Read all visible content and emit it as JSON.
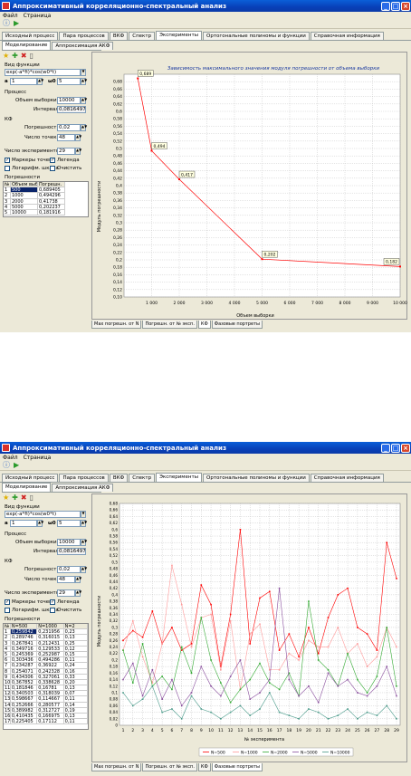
{
  "app": {
    "title": "Аппроксимативный корреляционно-спектральный анализ",
    "menu": [
      "Файл",
      "Страница"
    ]
  },
  "tabs": [
    "Исходный процесс",
    "Пара процессов",
    "ВКФ",
    "Спектр",
    "Эксперименты",
    "Ортогональные полиномы и функции",
    "Справочная информация"
  ],
  "active_tab": "Эксперименты",
  "subtabs": [
    "Моделирование",
    "Аппроксимация АКФ"
  ],
  "left_panel": {
    "func_label": "Вид функции",
    "func_value": "exp(-a*fi)*cos(w0*t)",
    "a_label": "a",
    "a_value": "1",
    "w0_label": "ω0",
    "w0_value": "5",
    "process_label": "Процесс",
    "sample_label": "Объем выборки",
    "sample_value_1": "10000",
    "sample_value_2": "10000",
    "interval_label": "Интервал",
    "interval_value": "0,0816497",
    "kf_label": "КФ",
    "err_label": "Погрешность",
    "err_value": "0,02",
    "points_label": "Число точек",
    "points_value": "48",
    "experiments_label": "Число экспериментов",
    "experiments_value": "29",
    "markers_label": "Маркеры точек",
    "legend_label": "Легенда",
    "log_label": "Логарифм. шкала",
    "clear_label": "Очистить",
    "errors_label": "Погрешности"
  },
  "table1": {
    "headers": [
      "№",
      "Объем выборки",
      "Погрешн."
    ],
    "rows": [
      [
        "1",
        "500",
        "0,689405"
      ],
      [
        "2",
        "1000",
        "0,494296"
      ],
      [
        "3",
        "2000",
        "0,41738"
      ],
      [
        "4",
        "5000",
        "0,202237"
      ],
      [
        "5",
        "10000",
        "0,181916"
      ]
    ]
  },
  "table2": {
    "headers": [
      "№",
      "N=500",
      "N=1000",
      "N=2"
    ],
    "rows": [
      [
        "1",
        "0,259842",
        "0,231956",
        "0,23"
      ],
      [
        "2",
        "0,289746",
        "0,316015",
        "0,13"
      ],
      [
        "3",
        "0,267841",
        "0,212431",
        "0,25"
      ],
      [
        "4",
        "0,349716",
        "0,129533",
        "0,12"
      ],
      [
        "5",
        "0,245369",
        "0,252987",
        "0,15"
      ],
      [
        "6",
        "0,303436",
        "0,494286",
        "0,11"
      ],
      [
        "7",
        "0,234287",
        "0,36922",
        "0,24"
      ],
      [
        "8",
        "0,254071",
        "0,242328",
        "0,16"
      ],
      [
        "9",
        "0,434306",
        "0,327061",
        "0,33"
      ],
      [
        "10",
        "0,367852",
        "0,338628",
        "0,20"
      ],
      [
        "11",
        "0,181846",
        "0,16781",
        "0,13"
      ],
      [
        "12",
        "0,340503",
        "0,318039",
        "0,07"
      ],
      [
        "13",
        "0,598667",
        "0,114667",
        "0,11"
      ],
      [
        "14",
        "0,252666",
        "0,280577",
        "0,14"
      ],
      [
        "15",
        "0,389982",
        "0,312727",
        "0,19"
      ],
      [
        "16",
        "0,410435",
        "0,166975",
        "0,13"
      ],
      [
        "17",
        "0,225405",
        "0,17112",
        "0,11"
      ]
    ]
  },
  "chart_tabs": [
    "Мах погрешн. от N",
    "Погрешн. от № эксп.",
    "КФ",
    "Фазовые портреты"
  ],
  "chart1_tab": "КФ",
  "chart2_tab": "Фазовые портреты",
  "chart_data": [
    {
      "type": "line",
      "title": "Зависимость максимального значения модуля погрешности от объема выборки",
      "xlabel": "Объем выборки",
      "ylabel": "Модуль погрешности",
      "x": [
        500,
        1000,
        2000,
        5000,
        10000
      ],
      "series": [
        {
          "values": [
            0.689,
            0.494,
            0.417,
            0.202,
            0.182
          ]
        }
      ],
      "data_labels": [
        "0,689",
        "0,494",
        "0,417",
        "0,202",
        "0,182"
      ],
      "xlim": [
        0,
        10000
      ],
      "ylim": [
        0.1,
        0.7
      ],
      "x_ticks": [
        "1 000",
        "2 000",
        "3 000",
        "4 000",
        "5 000",
        "6 000",
        "7 000",
        "8 000",
        "9 000",
        "10 000"
      ],
      "y_ticks": [
        "0,10",
        "0,12",
        "0,14",
        "0,16",
        "0,18",
        "0,2",
        "0,22",
        "0,24",
        "0,26",
        "0,28",
        "0,3",
        "0,32",
        "0,34",
        "0,36",
        "0,38",
        "0,4",
        "0,42",
        "0,44",
        "0,46",
        "0,48",
        "0,5",
        "0,52",
        "0,54",
        "0,56",
        "0,58",
        "0,6",
        "0,62",
        "0,64",
        "0,66",
        "0,68"
      ],
      "grid": true,
      "color": "#ff0000"
    },
    {
      "type": "line",
      "title": "",
      "xlabel": "№ эксперимента",
      "ylabel": "Модуль погрешности",
      "x": [
        1,
        2,
        3,
        4,
        5,
        6,
        7,
        8,
        9,
        10,
        11,
        12,
        13,
        14,
        15,
        16,
        17,
        18,
        19,
        20,
        21,
        22,
        23,
        24,
        25,
        26,
        27,
        28,
        29
      ],
      "xlim": [
        1,
        29
      ],
      "ylim": [
        0,
        0.68
      ],
      "y_ticks": [
        "0",
        "0,02",
        "0,04",
        "0,06",
        "0,08",
        "0,1",
        "0,12",
        "0,14",
        "0,16",
        "0,18",
        "0,2",
        "0,22",
        "0,24",
        "0,26",
        "0,28",
        "0,3",
        "0,32",
        "0,34",
        "0,36",
        "0,38",
        "0,4",
        "0,42",
        "0,44",
        "0,46",
        "0,48",
        "0,5",
        "0,52",
        "0,54",
        "0,56",
        "0,58",
        "0,6",
        "0,62",
        "0,64",
        "0,66",
        "0,68"
      ],
      "grid": true,
      "legend_position": "bottom",
      "series": [
        {
          "name": "N=500",
          "color": "#ff0000",
          "values": [
            0.26,
            0.29,
            0.27,
            0.35,
            0.25,
            0.3,
            0.23,
            0.25,
            0.43,
            0.37,
            0.18,
            0.34,
            0.6,
            0.25,
            0.39,
            0.41,
            0.23,
            0.28,
            0.21,
            0.3,
            0.22,
            0.33,
            0.4,
            0.42,
            0.3,
            0.28,
            0.23,
            0.56,
            0.45
          ]
        },
        {
          "name": "N=1000",
          "color": "#ff9999",
          "values": [
            0.23,
            0.32,
            0.21,
            0.13,
            0.25,
            0.49,
            0.37,
            0.24,
            0.33,
            0.34,
            0.17,
            0.32,
            0.11,
            0.28,
            0.31,
            0.17,
            0.17,
            0.22,
            0.2,
            0.26,
            0.24,
            0.24,
            0.3,
            0.22,
            0.25,
            0.18,
            0.21,
            0.3,
            0.24
          ]
        },
        {
          "name": "N=2000",
          "color": "#33aa33",
          "values": [
            0.23,
            0.13,
            0.25,
            0.12,
            0.15,
            0.11,
            0.24,
            0.16,
            0.33,
            0.2,
            0.13,
            0.07,
            0.11,
            0.14,
            0.19,
            0.13,
            0.11,
            0.16,
            0.09,
            0.38,
            0.2,
            0.17,
            0.12,
            0.22,
            0.14,
            0.1,
            0.15,
            0.3,
            0.12
          ]
        },
        {
          "name": "N=5000",
          "color": "#8a4f9e",
          "values": [
            0.14,
            0.19,
            0.09,
            0.17,
            0.08,
            0.14,
            0.06,
            0.1,
            0.18,
            0.12,
            0.09,
            0.15,
            0.2,
            0.08,
            0.1,
            0.14,
            0.42,
            0.14,
            0.09,
            0.12,
            0.07,
            0.16,
            0.12,
            0.14,
            0.1,
            0.09,
            0.12,
            0.18,
            0.09
          ]
        },
        {
          "name": "N=10000",
          "color": "#4a9a8a",
          "values": [
            0.1,
            0.06,
            0.08,
            0.12,
            0.04,
            0.05,
            0.02,
            0.09,
            0.05,
            0.04,
            0.02,
            0.04,
            0.06,
            0.03,
            0.05,
            0.1,
            0.04,
            0.03,
            0.02,
            0.05,
            0.04,
            0.02,
            0.03,
            0.05,
            0.02,
            0.04,
            0.03,
            0.06,
            0.02
          ]
        }
      ]
    }
  ]
}
